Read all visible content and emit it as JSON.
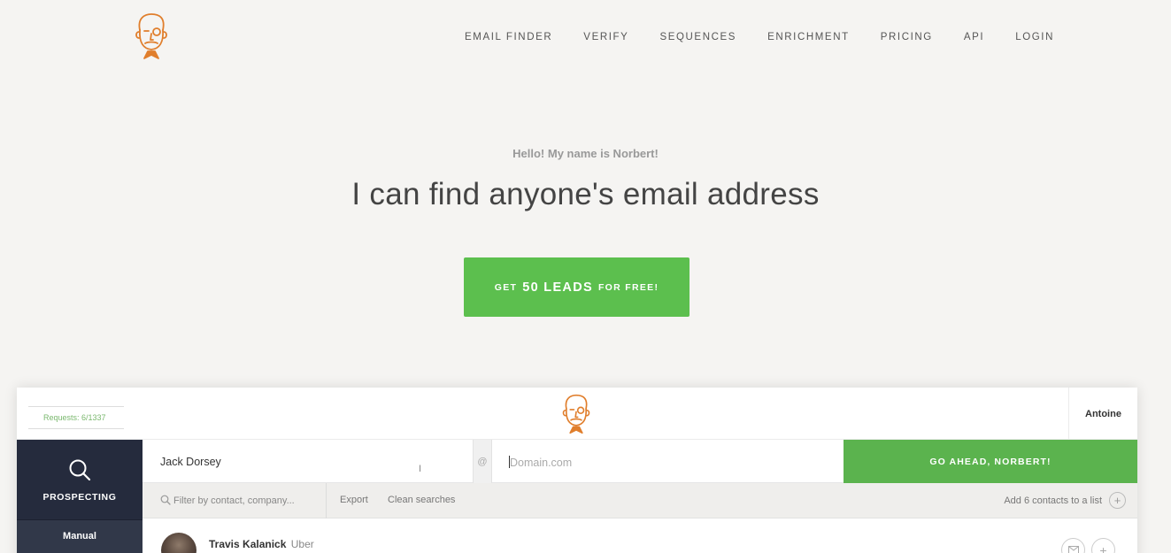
{
  "nav": {
    "items": [
      "EMAIL FINDER",
      "VERIFY",
      "SEQUENCES",
      "ENRICHMENT",
      "PRICING",
      "API",
      "LOGIN"
    ]
  },
  "hero": {
    "greeting": "Hello! My name is Norbert!",
    "headline": "I can find anyone's email address",
    "cta": {
      "prefix": "GET",
      "emphasis": "50 LEADS",
      "suffix": "FOR FREE!"
    }
  },
  "app": {
    "requests": "Requests: 6/1337",
    "user": "Antoine",
    "sidebar": {
      "prospecting": "PROSPECTING",
      "manual": "Manual"
    },
    "search": {
      "name_value": "Jack Dorsey",
      "at": "@",
      "domain_placeholder": "Domain.com",
      "go_button": "GO AHEAD, NORBERT!"
    },
    "toolbar": {
      "filter_placeholder": "Filter by contact, company...",
      "export": "Export",
      "clean": "Clean searches",
      "add_to_list": "Add 6 contacts to a list"
    },
    "rows": [
      {
        "name": "Travis Kalanick",
        "company": "Uber"
      }
    ]
  },
  "colors": {
    "brand_green": "#5cbf4e",
    "logo_orange": "#e07e2c",
    "sidebar_dark": "#252b3d",
    "background": "#f5f4f2"
  },
  "icons": {
    "logo": "norbert-face-icon",
    "sidebar": "search-icon",
    "filter": "search-icon",
    "add": "plus-icon",
    "mail": "mail-icon"
  }
}
